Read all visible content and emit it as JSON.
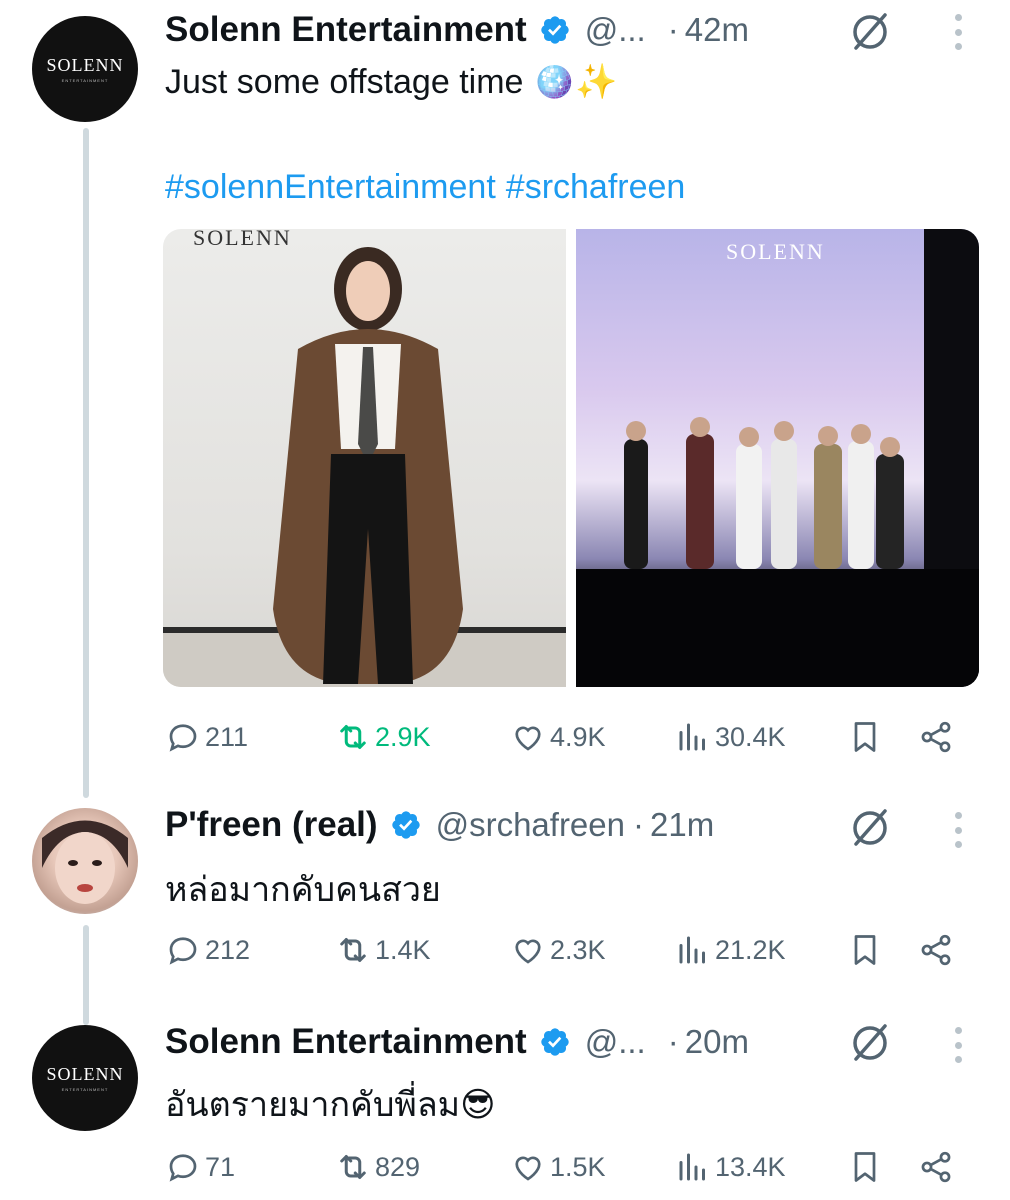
{
  "colors": {
    "text": "#0f1419",
    "secondary": "#536471",
    "link": "#1d9bf0",
    "verified": "#1d9bf0",
    "retweet_active": "#00ba7c",
    "thread_line": "#cfd9de"
  },
  "tweets": [
    {
      "author": "Solenn Entertainment",
      "handle": "@...",
      "time": "42m",
      "avatar_logo": "SOLENN",
      "text": "Just some offstage time 🪩✨",
      "hashtags": [
        "#solennEntertainment",
        "#srchafreen"
      ],
      "media": [
        {
          "watermark": "SOLENN",
          "icon": "photo-woman-brown-coat"
        },
        {
          "watermark": "SOLENN",
          "icon": "photo-stage-group"
        }
      ],
      "replies": "211",
      "reposts": "2.9K",
      "likes": "4.9K",
      "views": "30.4K",
      "reposted": true
    },
    {
      "author": "P'freen (real)",
      "handle": "@srchafreen",
      "time": "21m",
      "text": "หล่อมากคับคนสวย",
      "replies": "212",
      "reposts": "1.4K",
      "likes": "2.3K",
      "views": "21.2K",
      "reposted": false
    },
    {
      "author": "Solenn Entertainment",
      "handle": "@...",
      "time": "20m",
      "avatar_logo": "SOLENN",
      "text": "อันตรายมากคับพี่ลม😎",
      "replies": "71",
      "reposts": "829",
      "likes": "1.5K",
      "views": "13.4K",
      "reposted": false
    }
  ]
}
